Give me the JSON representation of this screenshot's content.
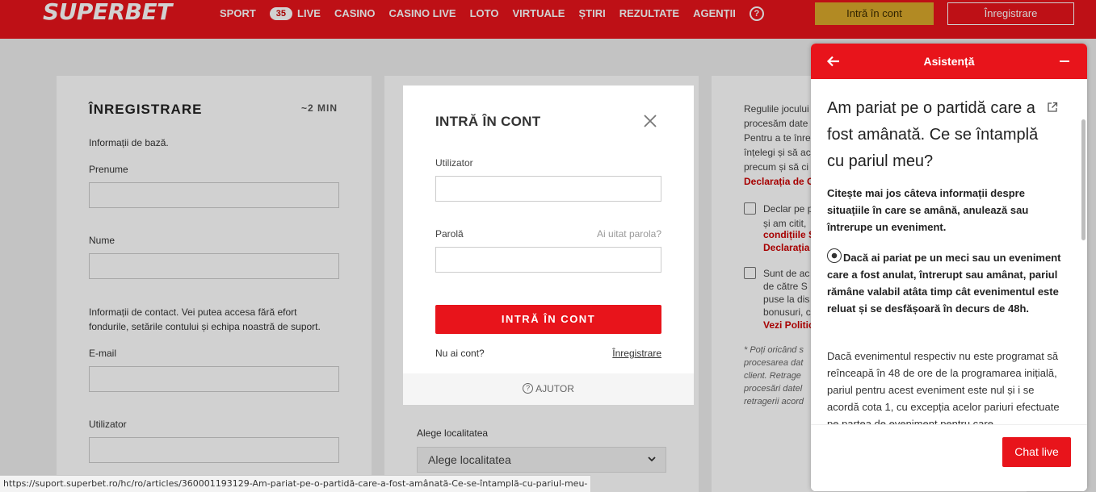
{
  "header": {
    "logo": "SUPERBET",
    "nav": [
      "SPORT",
      "LIVE",
      "CASINO",
      "CASINO LIVE",
      "LOTO",
      "VIRTUALE",
      "ȘTIRI",
      "REZULTATE",
      "AGENȚII"
    ],
    "live_count": "35",
    "help_glyph": "?",
    "login_label": "Intră în cont",
    "register_label": "Înregistrare"
  },
  "registration": {
    "title": "ÎNREGISTRARE",
    "time": "~2 MIN",
    "basic_info": "Informații de bază.",
    "first_name_label": "Prenume",
    "last_name_label": "Nume",
    "contact_info_line1": "Informații de contact. Vei putea accesa fără efort",
    "contact_info_line2": "fondurile, setările contului și echipa noastră de suport.",
    "email_label": "E-mail",
    "username_label": "Utilizator"
  },
  "location": {
    "label": "Alege localitatea",
    "placeholder": "Alege localitatea"
  },
  "terms": {
    "line1": "Regulile jocului",
    "line2": "procesăm date",
    "line3": "Pentru a te înre",
    "line4": "înțelegi și să ac",
    "line5": "precum și să ci",
    "link1": "Declarația de C",
    "check1_line1": "Declar pe p",
    "check1_line2": "și am citit,",
    "check1_link1": "condițiile S",
    "check1_link2": "Declarația",
    "check2_line1": "Sunt de ac",
    "check2_line2": "de către S",
    "check2_line3": "puse la dis",
    "check2_line4": "bonusuri, c",
    "check2_link": "Vezi Politic",
    "note1": "* Poți oricând s",
    "note2": "procesarea dat",
    "note3": "client. Retrage",
    "note4": "procesări datel",
    "note5": "retragerii acord"
  },
  "login_modal": {
    "title": "INTRĂ ÎN CONT",
    "username_label": "Utilizator",
    "password_label": "Parolă",
    "forgot_label": "Ai uitat parola?",
    "submit_label": "INTRĂ ÎN CONT",
    "no_account": "Nu ai cont?",
    "register_link": "Înregistrare",
    "help_label": "AJUTOR"
  },
  "help_widget": {
    "title": "Asistență",
    "article_title": "Am pariat pe o partidă care a fost amânată. Ce se întamplă cu pariul meu?",
    "intro": "Citește mai jos câteva informații despre situațiile în care se amână, anulează sau întrerupe un eveniment.",
    "highlight": "Dacă ai pariat pe un meci sau un eveniment care a fost anulat, întrerupt sau amânat, pariul rămâne valabil atâta timp cât evenimentul este reluat și se desfășoară în decurs de 48h.",
    "body": "Dacă evenimentul respectiv nu este programat să reînceapă în 48 de ore de la programarea inițială, pariul pentru acest eveniment este nul și i se acordă cota 1, cu excepția acelor pariuri efectuate pe partea de eveniment pentru care",
    "chat_label": "Chat live",
    "icons": {
      "back": "arrow-left-icon",
      "minimize": "minus-icon",
      "external": "external-link-icon",
      "emoji": "soccer-ball-icon"
    }
  },
  "status_bar": {
    "url": "https://suport.superbet.ro/hc/ro/articles/360001193129-Am-pariat-pe-o-partidă-care-a-fost-amânată-Ce-se-întamplă-cu-pariul-meu-"
  },
  "colors": {
    "brand_red": "#e8141b",
    "gold": "#d9a92b"
  }
}
